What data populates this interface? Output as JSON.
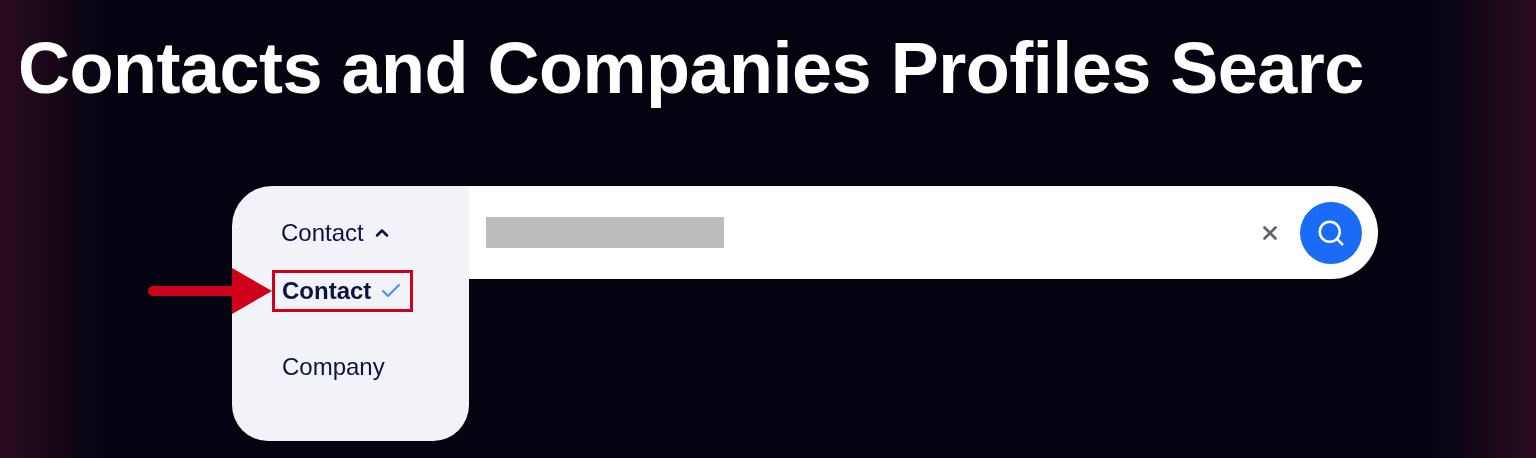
{
  "title": "Contacts and Companies Profiles Searc",
  "search": {
    "type_select": {
      "value": "Contact",
      "expanded": true,
      "options": [
        {
          "label": "Contact",
          "selected": true
        },
        {
          "label": "Company",
          "selected": false
        }
      ]
    }
  }
}
